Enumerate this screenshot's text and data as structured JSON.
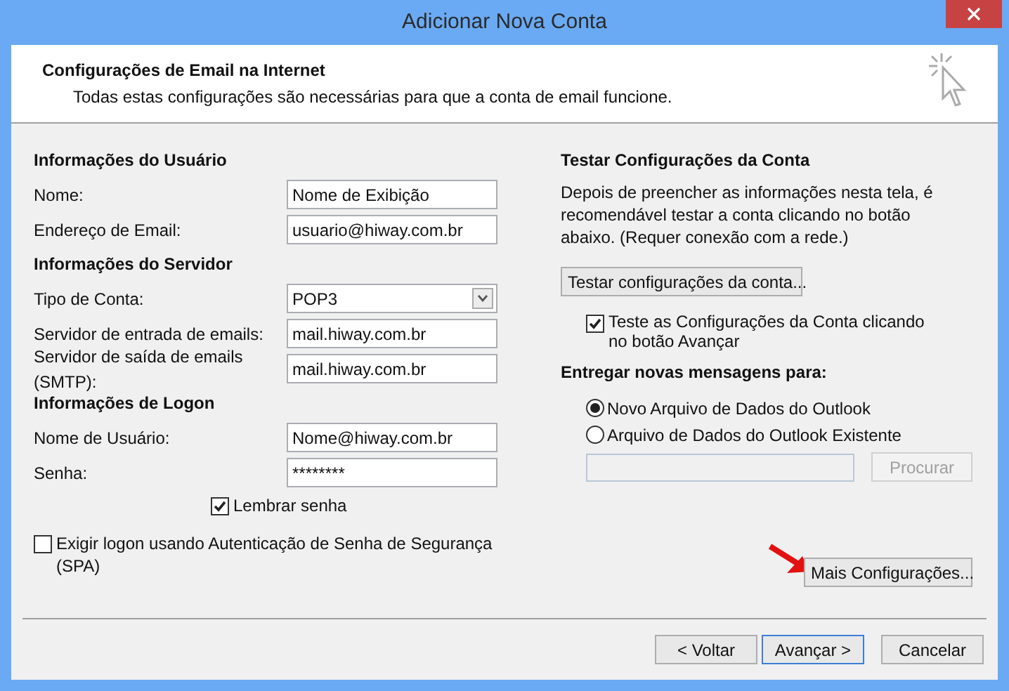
{
  "window": {
    "title": "Adicionar Nova Conta"
  },
  "header": {
    "title": "Configurações de Email na Internet",
    "subtitle": "Todas estas configurações são necessárias para que a conta de email funcione."
  },
  "left_sections": [
    {
      "heading": "Informações do Usuário",
      "fields": [
        {
          "kind": "text",
          "label": "Nome:",
          "value": "Nome de Exibição"
        },
        {
          "kind": "text",
          "label": "Endereço de Email:",
          "value": "usuario@hiway.com.br"
        }
      ]
    },
    {
      "heading": "Informações do Servidor",
      "fields": [
        {
          "kind": "select",
          "label": "Tipo de Conta:",
          "value": "POP3"
        },
        {
          "kind": "text",
          "label": "Servidor de entrada de emails:",
          "value": "mail.hiway.com.br"
        },
        {
          "kind": "text",
          "label": "Servidor de saída de emails (SMTP):",
          "value": "mail.hiway.com.br"
        }
      ]
    },
    {
      "heading": "Informações de Logon",
      "fields": [
        {
          "kind": "text",
          "label": "Nome de Usuário:",
          "value": "Nome@hiway.com.br"
        },
        {
          "kind": "text",
          "label": "Senha:",
          "value": "********"
        }
      ]
    }
  ],
  "remember_password": {
    "label": "Lembrar senha",
    "checked": true
  },
  "spa": {
    "label": "Exigir logon usando Autenticação de Senha de Segurança (SPA)",
    "checked": false
  },
  "test": {
    "heading": "Testar Configurações da Conta",
    "description": "Depois de preencher as informações nesta tela, é recomendável testar a conta clicando no botão abaixo. (Requer conexão com a rede.)",
    "button": "Testar configurações da conta...",
    "auto_test": {
      "label": "Teste as Configurações da Conta clicando no botão Avançar",
      "checked": true
    }
  },
  "deliver": {
    "heading": "Entregar novas mensagens para:",
    "options": [
      {
        "label": "Novo Arquivo de Dados do Outlook",
        "selected": true
      },
      {
        "label": "Arquivo de Dados do Outlook Existente",
        "selected": false
      }
    ],
    "browse_button": {
      "label": "Procurar",
      "disabled": true
    }
  },
  "more_settings_button": "Mais Configurações...",
  "buttons": [
    {
      "label": "< Voltar",
      "default": false
    },
    {
      "label": "Avançar >",
      "default": true
    },
    {
      "label": "Cancelar",
      "default": false
    }
  ]
}
